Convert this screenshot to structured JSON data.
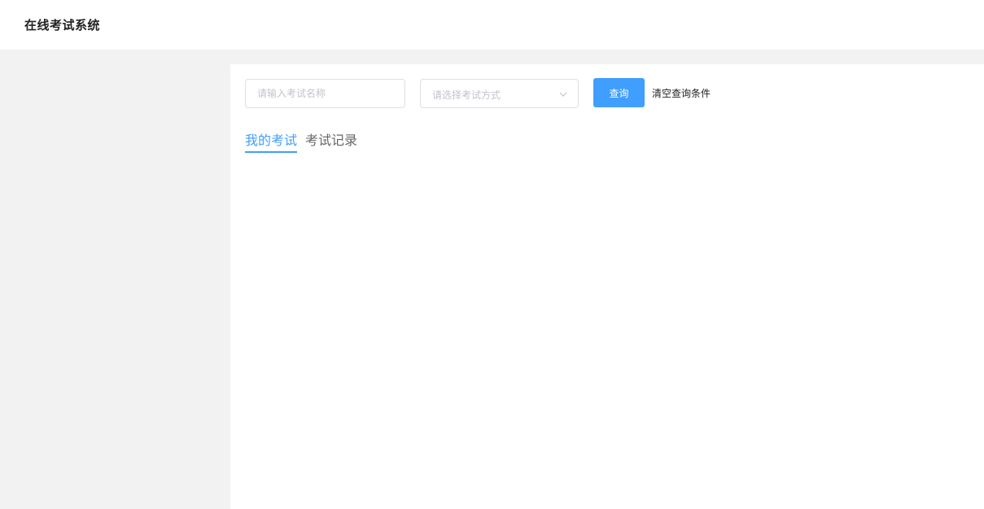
{
  "header": {
    "title": "在线考试系统"
  },
  "search": {
    "name_placeholder": "请输入考试名称",
    "mode_placeholder": "请选择考试方式",
    "query_label": "查询",
    "clear_label": "清空查询条件"
  },
  "tabs": [
    {
      "label": "我的考试",
      "active": true
    },
    {
      "label": "考试记录",
      "active": false
    }
  ],
  "colors": {
    "accent": "#409eff",
    "page_bg": "#f2f2f2",
    "border": "#dcdfe6",
    "placeholder": "#c0c4cc"
  },
  "icons": {
    "select_arrow": "chevron-down-icon"
  }
}
